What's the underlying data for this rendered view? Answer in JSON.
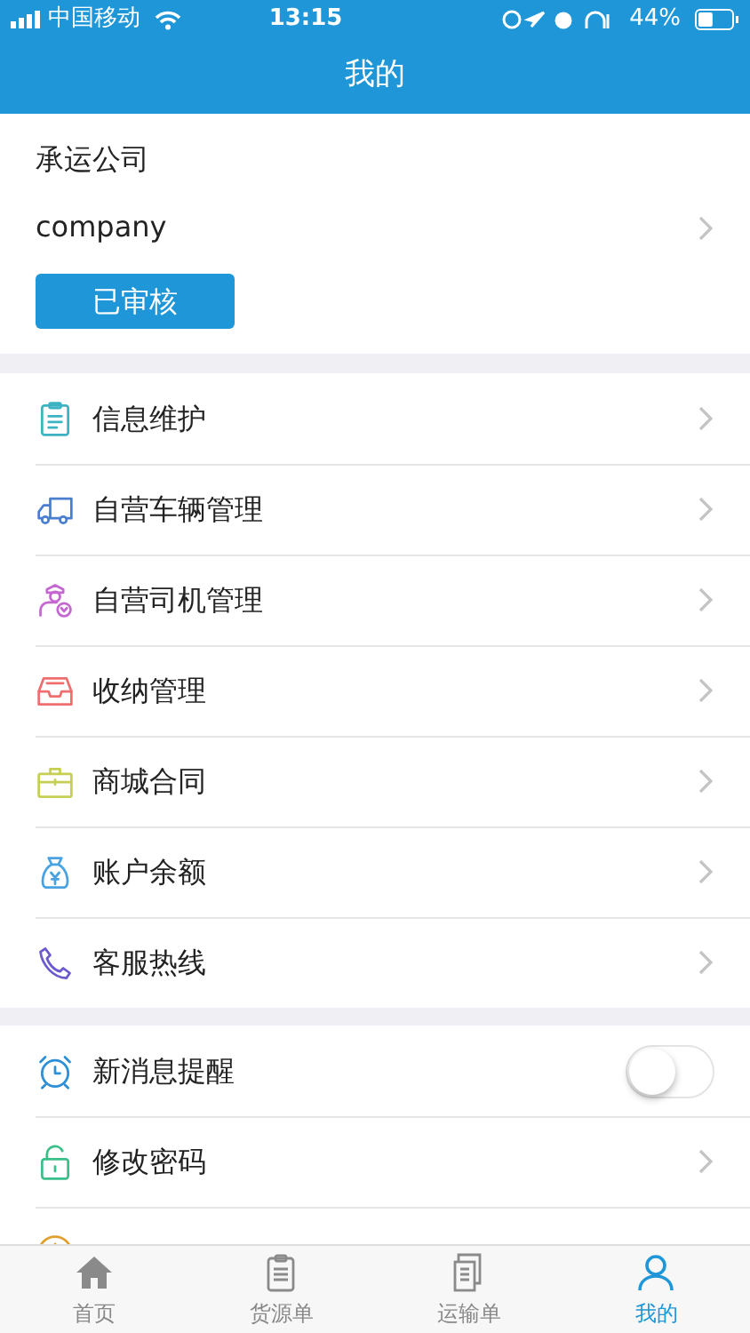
{
  "status_bar": {
    "carrier": "中国移动",
    "time": "13:15",
    "battery": "44%"
  },
  "nav": {
    "title": "我的"
  },
  "profile": {
    "label": "承运公司",
    "name": "company",
    "status_button": "已审核"
  },
  "groups": [
    {
      "items": [
        {
          "kind": "link",
          "label": "信息维护"
        },
        {
          "kind": "link",
          "label": "自营车辆管理"
        },
        {
          "kind": "link",
          "label": "自营司机管理"
        },
        {
          "kind": "link",
          "label": "收纳管理"
        },
        {
          "kind": "link",
          "label": "商城合同"
        },
        {
          "kind": "link",
          "label": "账户余额"
        },
        {
          "kind": "link",
          "label": "客服热线"
        }
      ]
    },
    {
      "items": [
        {
          "kind": "toggle",
          "label": "新消息提醒",
          "on": false
        },
        {
          "kind": "link",
          "label": "修改密码"
        },
        {
          "kind": "partial"
        }
      ]
    }
  ],
  "tabs": [
    {
      "label": "首页",
      "selected": false
    },
    {
      "label": "货源单",
      "selected": false
    },
    {
      "label": "运输单",
      "selected": false
    },
    {
      "label": "我的",
      "selected": true
    }
  ]
}
